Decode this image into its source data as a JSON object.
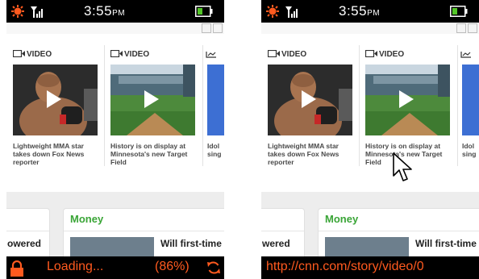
{
  "status_bar": {
    "time": "3:55",
    "meridiem": "PM"
  },
  "video_label": "VIDEO",
  "cards": [
    {
      "caption": "Lightweight MMA star takes down Fox News reporter",
      "thumbnail": "mma-fighter-photo"
    },
    {
      "caption": "History is on display at Minnesota's new Target Field",
      "thumbnail": "ballpark-photo"
    },
    {
      "caption_fragment": "Idol sing",
      "thumbnail": "blue-photo"
    }
  ],
  "money_panel": {
    "title": "Money",
    "headline_fragment": "Will first-time",
    "left_fragment": "owered",
    "left_fragment_right_screen": "wered"
  },
  "left_bottom_bar": {
    "status": "Loading...",
    "percent": "(86%)",
    "icons": [
      "lock-icon",
      "refresh-icon"
    ]
  },
  "right_bottom_bar": {
    "url": "http://cnn.com/story/video/0"
  },
  "colors": {
    "bar_text": "#ff5a1f",
    "money_green": "#3aa537",
    "status_bar": "#000000"
  }
}
